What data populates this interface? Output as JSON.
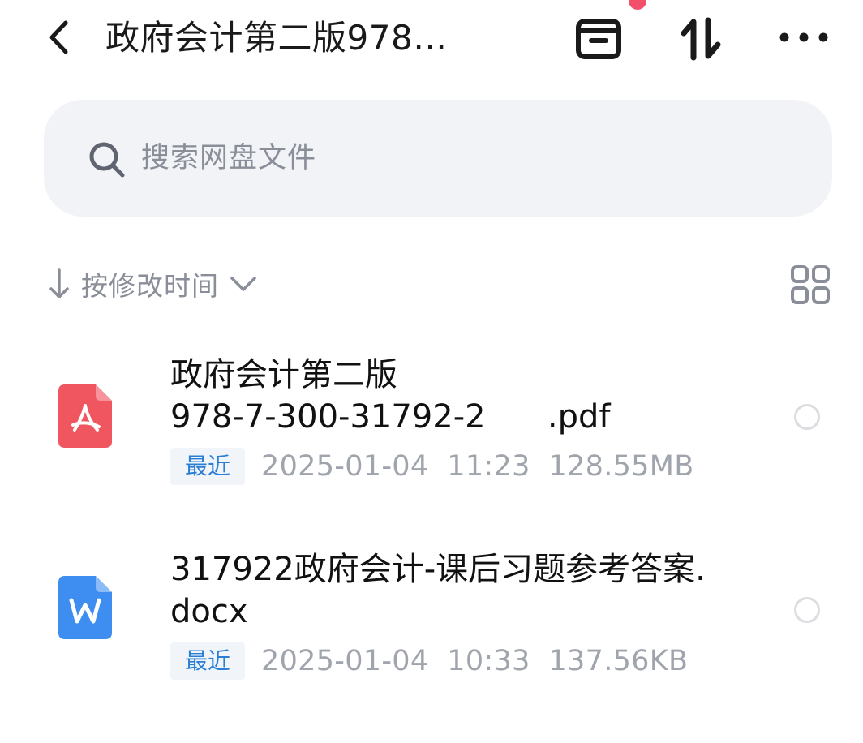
{
  "header": {
    "title": "政府会计第二版978…",
    "back_icon": "chevron-left-icon",
    "archive_icon": "archive-box-icon",
    "sort_icon": "sort-arrows-icon",
    "more_icon": "more-dots-icon",
    "notification_dot_color": "#f2506a"
  },
  "search": {
    "placeholder": "搜索网盘文件",
    "icon": "search-icon"
  },
  "sort": {
    "label": "按修改时间",
    "direction": "descending",
    "view_toggle_icon": "grid-view-icon"
  },
  "files": [
    {
      "name": "政府会计第二版\n978-7-300-31792-2      .pdf",
      "type_icon": "pdf-file-icon",
      "icon_color": "#f0565f",
      "badge": "最近",
      "meta": "2025-01-04  11:23  128.55MB"
    },
    {
      "name": "317922政府会计-课后习题参考答案.docx",
      "type_icon": "word-file-icon",
      "icon_color": "#3d8ef0",
      "badge": "最近",
      "meta": "2025-01-04  10:33  137.56KB"
    }
  ],
  "colors": {
    "accent_badge": "#2a7fd4",
    "muted_text": "#8a8e99",
    "search_bg": "#f2f3f7"
  }
}
